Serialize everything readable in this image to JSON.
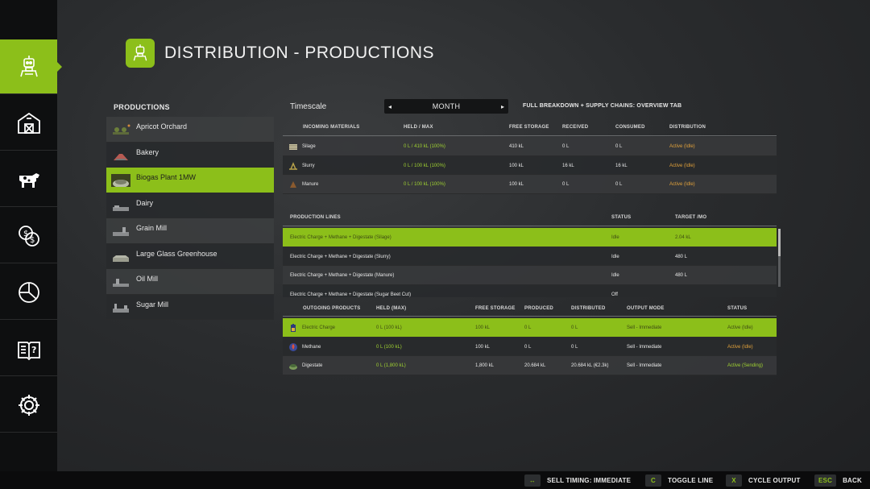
{
  "header": {
    "title": "DISTRIBUTION - PRODUCTIONS",
    "icon": "production-icon"
  },
  "rail": {
    "items": [
      {
        "icon": "production-icon",
        "active": true
      },
      {
        "icon": "barn-icon",
        "active": false
      },
      {
        "icon": "cow-icon",
        "active": false
      },
      {
        "icon": "finance-icon",
        "active": false
      },
      {
        "icon": "pie-chart-icon",
        "active": false
      },
      {
        "icon": "help-book-icon",
        "active": false
      },
      {
        "icon": "gear-icon",
        "active": false
      }
    ]
  },
  "productions": {
    "title": "PRODUCTIONS",
    "items": [
      {
        "label": "Apricot Orchard",
        "selected": false
      },
      {
        "label": "Bakery",
        "selected": false
      },
      {
        "label": "Biogas Plant 1MW",
        "selected": true
      },
      {
        "label": "Dairy",
        "selected": false
      },
      {
        "label": "Grain Mill",
        "selected": false
      },
      {
        "label": "Large Glass Greenhouse",
        "selected": false
      },
      {
        "label": "Oil Mill",
        "selected": false
      },
      {
        "label": "Sugar Mill",
        "selected": false
      }
    ]
  },
  "timescale": {
    "label": "Timescale",
    "value": "MONTH",
    "prev": "◂",
    "next": "▸"
  },
  "overview_label": "FULL BREAKDOWN + SUPPLY CHAINS: OVERVIEW TAB",
  "incoming": {
    "headers": [
      "INCOMING MATERIALS",
      "HELD / MAX",
      "FREE STORAGE",
      "RECEIVED",
      "CONSUMED",
      "DISTRIBUTION"
    ],
    "rows": [
      {
        "name": "Silage",
        "held": "0 L / 410 kL (100%)",
        "free": "410 kL",
        "received": "0 L",
        "consumed": "0 L",
        "distribution": "Active (Idle)"
      },
      {
        "name": "Slurry",
        "held": "0 L / 100 kL (100%)",
        "free": "100 kL",
        "received": "16 kL",
        "consumed": "16 kL",
        "distribution": "Active (Idle)"
      },
      {
        "name": "Manure",
        "held": "0 L / 100 kL (100%)",
        "free": "100 kL",
        "received": "0 L",
        "consumed": "0 L",
        "distribution": "Active (Idle)"
      }
    ]
  },
  "lines": {
    "headers": [
      "PRODUCTION LINES",
      "STATUS",
      "TARGET /MO"
    ],
    "rows": [
      {
        "name": "Electric Charge + Methane + Digestate (Silage)",
        "status": "Idle",
        "target": "2.04 kL",
        "selected": true
      },
      {
        "name": "Electric Charge + Methane + Digestate (Slurry)",
        "status": "Idle",
        "target": "480 L",
        "selected": false
      },
      {
        "name": "Electric Charge + Methane + Digestate (Manure)",
        "status": "Idle",
        "target": "480 L",
        "selected": false
      },
      {
        "name": "Electric Charge + Methane + Digestate (Sugar Beet Cut)",
        "status": "Off",
        "target": "",
        "selected": false
      }
    ]
  },
  "outgoing": {
    "headers": [
      "OUTGOING PRODUCTS",
      "HELD (MAX)",
      "FREE STORAGE",
      "PRODUCED",
      "DISTRIBUTED",
      "OUTPUT MODE",
      "STATUS"
    ],
    "rows": [
      {
        "name": "Electric Charge",
        "held": "0 L (100 kL)",
        "free": "100 kL",
        "produced": "0 L",
        "distributed": "0 L",
        "mode": "Sell - Immediate",
        "status": "Active (Idle)",
        "selected": true
      },
      {
        "name": "Methane",
        "held": "0 L (100 kL)",
        "free": "100 kL",
        "produced": "0 L",
        "distributed": "0 L",
        "mode": "Sell - Immediate",
        "status": "Active (Idle)",
        "selected": false
      },
      {
        "name": "Digestate",
        "held": "0 L (1,800 kL)",
        "free": "1,800 kL",
        "produced": "20.684 kL",
        "distributed": "20.684 kL (€2.3k)",
        "mode": "Sell - Immediate",
        "status": "Active (Sending)",
        "selected": false
      }
    ]
  },
  "footer": {
    "hints": [
      {
        "key": "↔",
        "label": "SELL TIMING: IMMEDIATE"
      },
      {
        "key": "C",
        "label": "TOGGLE LINE"
      },
      {
        "key": "X",
        "label": "CYCLE OUTPUT"
      },
      {
        "key": "ESC",
        "label": "BACK"
      }
    ]
  },
  "colors": {
    "accent": "#8cbf1a",
    "active_text": "#9fd131",
    "status_text": "#e0a13b"
  }
}
